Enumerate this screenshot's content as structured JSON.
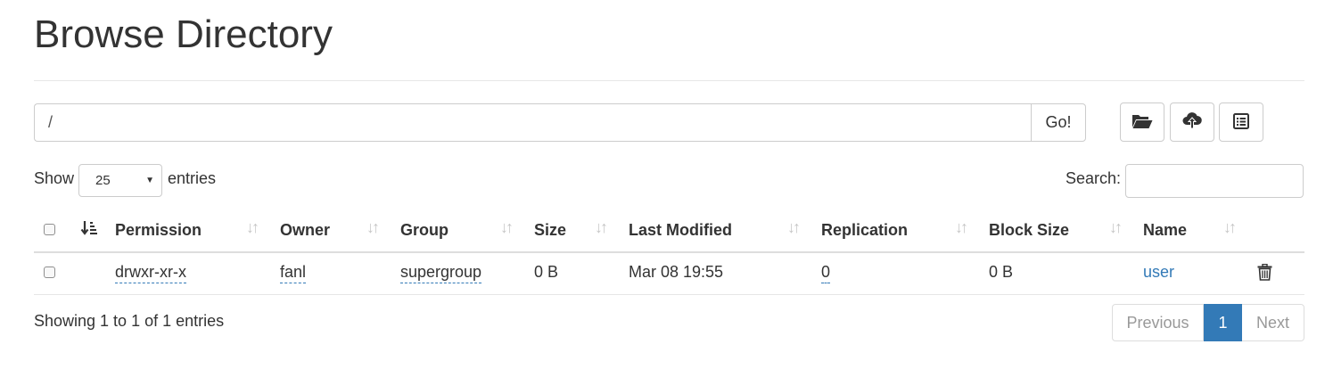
{
  "page": {
    "title": "Browse Directory"
  },
  "pathbar": {
    "value": "/",
    "go_label": "Go!"
  },
  "toolbar": {
    "icons": [
      "folder-open-icon",
      "cloud-upload-icon",
      "list-alt-icon"
    ]
  },
  "length": {
    "show_label": "Show",
    "selected": "25",
    "entries_label": "entries"
  },
  "search": {
    "label": "Search:",
    "value": ""
  },
  "table": {
    "columns": [
      "Permission",
      "Owner",
      "Group",
      "Size",
      "Last Modified",
      "Replication",
      "Block Size",
      "Name"
    ],
    "rows": [
      {
        "permission": "drwxr-xr-x",
        "owner": "fanl",
        "group": "supergroup",
        "size": "0 B",
        "last_modified": "Mar 08 19:55",
        "replication": "0",
        "block_size": "0 B",
        "name": "user"
      }
    ]
  },
  "footer": {
    "info": "Showing 1 to 1 of 1 entries",
    "pagination": {
      "previous": "Previous",
      "current": "1",
      "next": "Next"
    }
  },
  "colors": {
    "link": "#337ab7",
    "active_page": "#337ab7",
    "border": "#cccccc"
  }
}
